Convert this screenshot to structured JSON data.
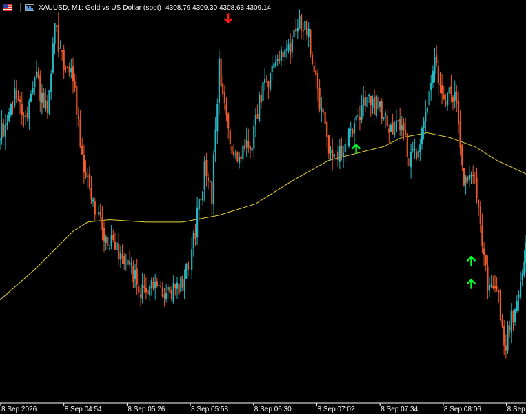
{
  "header": {
    "symbol": "XAUUSD",
    "timeframe": "M1",
    "description": "Gold vs US Dollar (spot)",
    "title": "XAUUSD, M1:  Gold vs US Dollar (spot)",
    "quotes": "4308.79 4309.30 4308.63 4309.14",
    "flag_icon": "us-flag-icon",
    "chart_icon": "chart-window-icon"
  },
  "colors": {
    "background": "#000000",
    "bull": "#26b8c2",
    "bear": "#f05a28",
    "ma_line": "#e6d23c",
    "arrow_buy": "#00ff2a",
    "arrow_sell": "#ff1a1a",
    "axis_text": "#ffffff"
  },
  "chart_data": {
    "type": "candlestick",
    "symbol": "XAUUSD",
    "timeframe": "M1",
    "x_tick_labels": [
      "8 Sep 2026",
      "8 Sep 04:54",
      "8 Sep 05:26",
      "8 Sep 05:58",
      "8 Sep 06:30",
      "8 Sep 07:02",
      "8 Sep 07:34",
      "8 Sep 08:06",
      "8 Sep 0"
    ],
    "time_range": [
      "8 Sep 04:22",
      "8 Sep 08:22"
    ],
    "y_range": [
      4303.4,
      4321.0
    ],
    "close_path": [
      [
        0,
        4315.0
      ],
      [
        8,
        4317.0
      ],
      [
        14,
        4315.5
      ],
      [
        20,
        4317.5
      ],
      [
        26,
        4316.0
      ],
      [
        30,
        4319.7
      ],
      [
        36,
        4318.0
      ],
      [
        40,
        4317.5
      ],
      [
        46,
        4313.5
      ],
      [
        52,
        4312.0
      ],
      [
        58,
        4310.5
      ],
      [
        64,
        4310.2
      ],
      [
        70,
        4309.5
      ],
      [
        78,
        4308.3
      ],
      [
        88,
        4308.5
      ],
      [
        96,
        4308.2
      ],
      [
        104,
        4309.4
      ],
      [
        108,
        4311.5
      ],
      [
        112,
        4313.5
      ],
      [
        116,
        4312.5
      ],
      [
        120,
        4318.2
      ],
      [
        124,
        4316.0
      ],
      [
        128,
        4314.2
      ],
      [
        132,
        4314.5
      ],
      [
        138,
        4314.8
      ],
      [
        142,
        4316.6
      ],
      [
        148,
        4317.7
      ],
      [
        152,
        4318.2
      ],
      [
        158,
        4318.8
      ],
      [
        162,
        4320.0
      ],
      [
        168,
        4319.8
      ],
      [
        176,
        4316.0
      ],
      [
        182,
        4314.0
      ],
      [
        186,
        4314.3
      ],
      [
        194,
        4315.4
      ],
      [
        200,
        4316.7
      ],
      [
        206,
        4316.4
      ],
      [
        210,
        4316.1
      ],
      [
        214,
        4315.2
      ],
      [
        218,
        4315.8
      ],
      [
        224,
        4314.2
      ],
      [
        230,
        4314.5
      ],
      [
        234,
        4316.4
      ],
      [
        238,
        4318.2
      ],
      [
        242,
        4316.6
      ],
      [
        246,
        4316.8
      ],
      [
        250,
        4316.5
      ],
      [
        254,
        4312.8
      ],
      [
        260,
        4313.5
      ],
      [
        264,
        4310.3
      ],
      [
        268,
        4308.2
      ],
      [
        272,
        4308.8
      ],
      [
        276,
        4305.8
      ],
      [
        280,
        4307.2
      ],
      [
        284,
        4307.8
      ],
      [
        288,
        4310.2
      ]
    ],
    "moving_average": [
      [
        0,
        4307.9
      ],
      [
        20,
        4309.3
      ],
      [
        40,
        4310.9
      ],
      [
        48,
        4311.3
      ],
      [
        60,
        4311.4
      ],
      [
        80,
        4311.3
      ],
      [
        100,
        4311.3
      ],
      [
        120,
        4311.6
      ],
      [
        140,
        4312.1
      ],
      [
        160,
        4313.1
      ],
      [
        180,
        4314.0
      ],
      [
        200,
        4314.4
      ],
      [
        210,
        4314.6
      ],
      [
        220,
        4315.0
      ],
      [
        234,
        4315.2
      ],
      [
        246,
        4315.0
      ],
      [
        260,
        4314.6
      ],
      [
        272,
        4314.0
      ],
      [
        288,
        4313.4
      ]
    ],
    "signals": [
      {
        "type": "sell",
        "minute": 125,
        "price": 4320.2
      },
      {
        "type": "buy",
        "minute": 195,
        "price": 4314.5
      },
      {
        "type": "buy",
        "minute": 258,
        "price": 4309.6
      },
      {
        "type": "buy",
        "minute": 258,
        "price": 4308.6
      }
    ]
  }
}
